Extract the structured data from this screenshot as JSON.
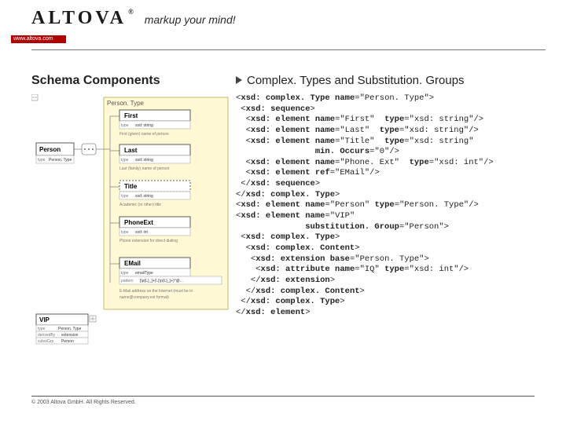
{
  "header": {
    "logo": "ALTOVA",
    "reg": "®",
    "tagline": "markup your mind!",
    "redbar": "www.altova.com"
  },
  "left": {
    "title": "Schema Components",
    "diagram": {
      "root": "Person",
      "root_type_label": "type",
      "root_type": "Person. Type",
      "group": "Person. Type",
      "elements": [
        {
          "name": "First",
          "type_label": "type",
          "type": "xsd: string",
          "note": "First (given) name of person"
        },
        {
          "name": "Last",
          "type_label": "type",
          "type": "xsd: string",
          "note": "Last (family) name of person"
        },
        {
          "name": "Title",
          "type_label": "type",
          "type": "xsd: string",
          "note": "Academic (or other) title"
        },
        {
          "name": "PhoneExt",
          "type_label": "type",
          "type": "xsd: int",
          "note": "Phone extension for direct dialing"
        },
        {
          "name": "EMail",
          "type_label": "type",
          "type": "emailType",
          "pattern_label": "pattern",
          "pattern": "[\\p{L}_]+(\\.[\\p{L}_]+)*@...",
          "note": "E-Mail address on the Internet (must be in name@company.ext format)"
        }
      ],
      "vip": {
        "name": "VIP",
        "rows": [
          {
            "label": "type",
            "value": "Person. Type"
          },
          {
            "label": "derivedBy",
            "value": "extension"
          },
          {
            "label": "substGrp",
            "value": "Person"
          }
        ]
      }
    }
  },
  "right": {
    "title": "Complex. Types and Substitution. Groups",
    "code_lines": [
      "<xsd: complex. Type name=\"Person. Type\">",
      " <xsd: sequence>",
      "  <xsd: element name=\"First\"  type=\"xsd: string\"/>",
      "  <xsd: element name=\"Last\"  type=\"xsd: string\"/>",
      "  <xsd: element name=\"Title\"  type=\"xsd: string\"",
      "                min. Occurs=\"0\"/>",
      "  <xsd: element name=\"Phone. Ext\"  type=\"xsd: int\"/>",
      "  <xsd: element ref=\"EMail\"/>",
      " </xsd: sequence>",
      "</xsd: complex. Type>",
      "<xsd: element name=\"Person\" type=\"Person. Type\"/>",
      "<xsd: element name=\"VIP\"",
      "              substitution. Group=\"Person\">",
      " <xsd: complex. Type>",
      "  <xsd: complex. Content>",
      "   <xsd: extension base=\"Person. Type\">",
      "    <xsd: attribute name=\"IQ\" type=\"xsd: int\"/>",
      "   </xsd: extension>",
      "  </xsd: complex. Content>",
      " </xsd: complex. Type>",
      "</xsd: element>"
    ]
  },
  "footer": {
    "copyright": "© 2003 Altova GmbH. All Rights Reserved."
  }
}
